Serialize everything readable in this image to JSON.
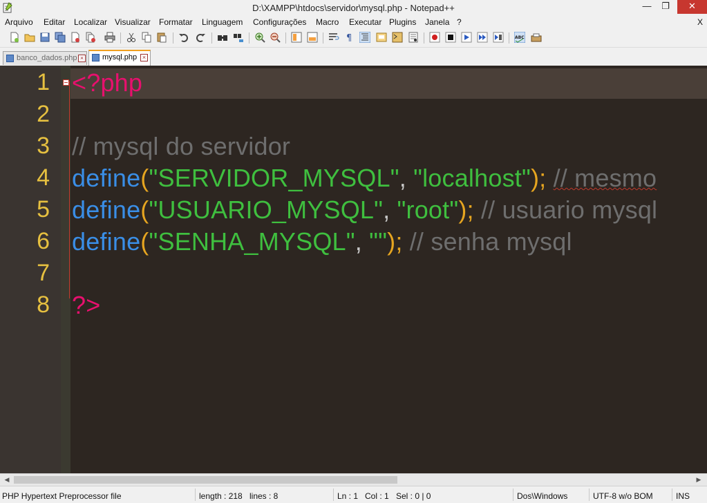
{
  "window": {
    "title": "D:\\XAMPP\\htdocs\\servidor\\mysql.php - Notepad++",
    "minimize_glyph": "—",
    "maximize_glyph": "❐",
    "close_glyph": "✕"
  },
  "menu": {
    "items": [
      "Arquivo",
      "Editar",
      "Localizar",
      "Visualizar",
      "Formatar",
      "Linguagem",
      "Configurações",
      "Macro",
      "Executar",
      "Plugins",
      "Janela",
      "?"
    ],
    "close_label": "X"
  },
  "toolbar": {
    "icons": [
      "new-file-icon",
      "open-file-icon",
      "save-icon",
      "save-all-icon",
      "close-icon",
      "close-all-icon",
      "print-icon",
      "cut-icon",
      "copy-icon",
      "paste-icon",
      "undo-icon",
      "redo-icon",
      "find-icon",
      "replace-icon",
      "zoom-in-icon",
      "zoom-out-icon",
      "sync-vertical-icon",
      "sync-horizontal-icon",
      "word-wrap-icon",
      "show-all-chars-icon",
      "indent-guide-icon",
      "user-lang-icon",
      "doc-map-icon",
      "function-list-icon",
      "record-macro-icon",
      "stop-macro-icon",
      "play-macro-icon",
      "run-macro-multiple-icon",
      "save-macro-icon",
      "spellcheck-icon",
      "change-dictionary-icon"
    ]
  },
  "tabs": [
    {
      "label": "banco_dados.php",
      "active": false
    },
    {
      "label": "mysql.php",
      "active": true
    }
  ],
  "editor": {
    "line_numbers": [
      "1",
      "2",
      "3",
      "4",
      "5",
      "6",
      "7",
      "8"
    ],
    "line1": {
      "tag": "<?php"
    },
    "line3": {
      "comment": "// mysql do servidor"
    },
    "line4": {
      "kw": "define",
      "open": "(",
      "s1": "\"SERVIDOR_MYSQL\"",
      "comma": ", ",
      "s2": "\"localhost\"",
      "close": ")",
      "semi": "; ",
      "comment": "// mesmo"
    },
    "line5": {
      "kw": "define",
      "open": "(",
      "s1": "\"USUARIO_MYSQL\"",
      "comma": ", ",
      "s2": "\"root\"",
      "close": ")",
      "semi": "; ",
      "comment": "// usuario mysql"
    },
    "line6": {
      "kw": "define",
      "open": "(",
      "s1": "\"SENHA_MYSQL\"",
      "comma": ", ",
      "s2": "\"\"",
      "close": ")",
      "semi": "; ",
      "comment": "// senha mysql"
    },
    "line8": {
      "tag": "?>"
    }
  },
  "statusbar": {
    "file_type": "PHP Hypertext Preprocessor file",
    "length": "length : 218",
    "lines": "lines : 8",
    "ln": "Ln : 1",
    "col": "Col : 1",
    "sel": "Sel : 0 | 0",
    "eol": "Dos\\Windows",
    "encoding": "UTF-8 w/o BOM",
    "mode": "INS"
  },
  "colors": {
    "editor_bg": "#2d2621",
    "gutter_bg": "#3a3430",
    "line_number": "#e6c040",
    "php_tag": "#e8106e",
    "keyword": "#3a8ee6",
    "string": "#3fbf3f",
    "paren": "#e6a520",
    "comment": "#6e6e6e"
  }
}
